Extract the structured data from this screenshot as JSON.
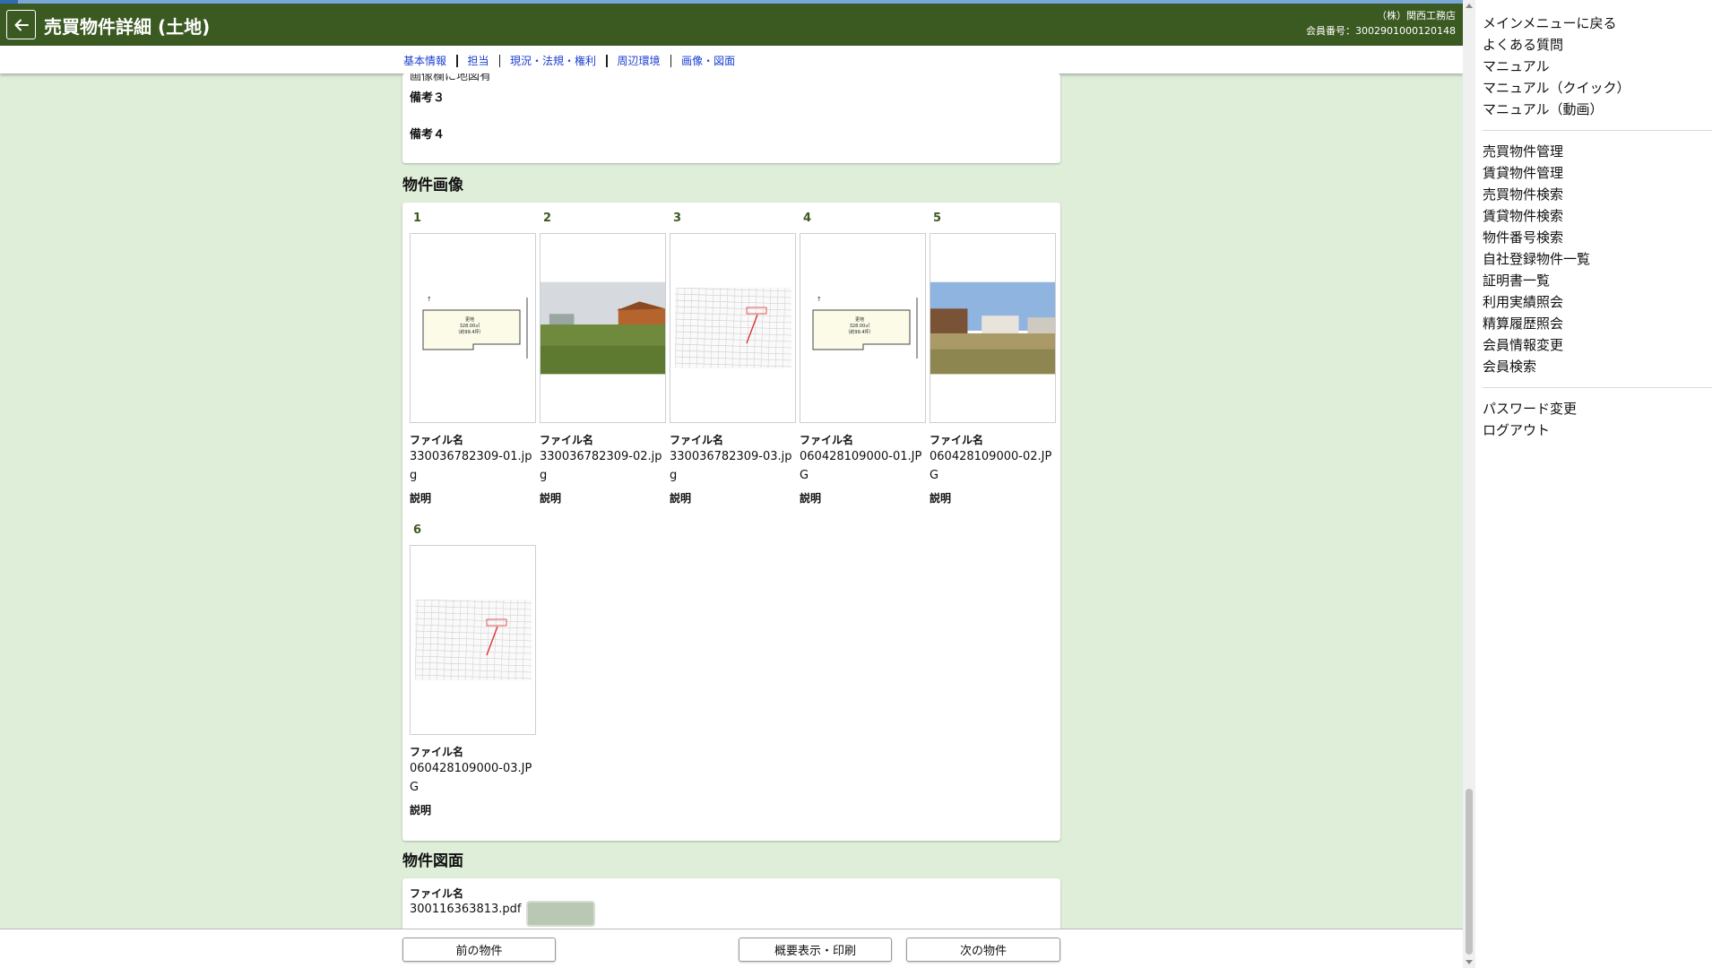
{
  "header": {
    "title": "売買物件詳細 (土地)",
    "company": "（株）関西工務店",
    "member_no": "会員番号：3002901000120148"
  },
  "subnav": [
    "基本情報",
    "担当",
    "現況・法規・権利",
    "周辺環境",
    "画像・図面"
  ],
  "notes": {
    "cut_text": "画像欄に地図有",
    "labels": [
      "備考３",
      "備考４"
    ]
  },
  "images_section": {
    "title": "物件画像",
    "file_label": "ファイル名",
    "desc_label": "説明",
    "items": [
      {
        "num": "1",
        "file": "330036782309-01.jpg",
        "kind": "plan"
      },
      {
        "num": "2",
        "file": "330036782309-02.jpg",
        "kind": "photo-field"
      },
      {
        "num": "3",
        "file": "330036782309-03.jpg",
        "kind": "map"
      },
      {
        "num": "4",
        "file": "060428109000-01.JPG",
        "kind": "plan"
      },
      {
        "num": "5",
        "file": "060428109000-02.JPG",
        "kind": "photo-sky"
      },
      {
        "num": "6",
        "file": "060428109000-03.JPG",
        "kind": "map"
      }
    ],
    "plan_text": [
      "更地",
      "328.00㎡",
      "（約99.4坪）"
    ]
  },
  "drawing_section": {
    "title": "物件図面",
    "file_label": "ファイル名",
    "file": "300116363813.pdf"
  },
  "footer": {
    "prev": "前の物件",
    "print": "概要表示・印刷",
    "next": "次の物件"
  },
  "sidebar": {
    "groups": [
      [
        "メインメニューに戻る",
        "よくある質問",
        "マニュアル",
        "マニュアル（クイック）",
        "マニュアル（動画）"
      ],
      [
        "売買物件管理",
        "賃貸物件管理",
        "売買物件検索",
        "賃貸物件検索",
        "物件番号検索",
        "自社登録物件一覧",
        "証明書一覧",
        "利用実績照会",
        "精算履歴照会",
        "会員情報変更",
        "会員検索"
      ],
      [
        "パスワード変更",
        "ログアウト"
      ]
    ]
  },
  "colors": {
    "header_bg": "#3b5a22",
    "page_bg": "#dfeed8",
    "link": "#1a3fd0"
  }
}
